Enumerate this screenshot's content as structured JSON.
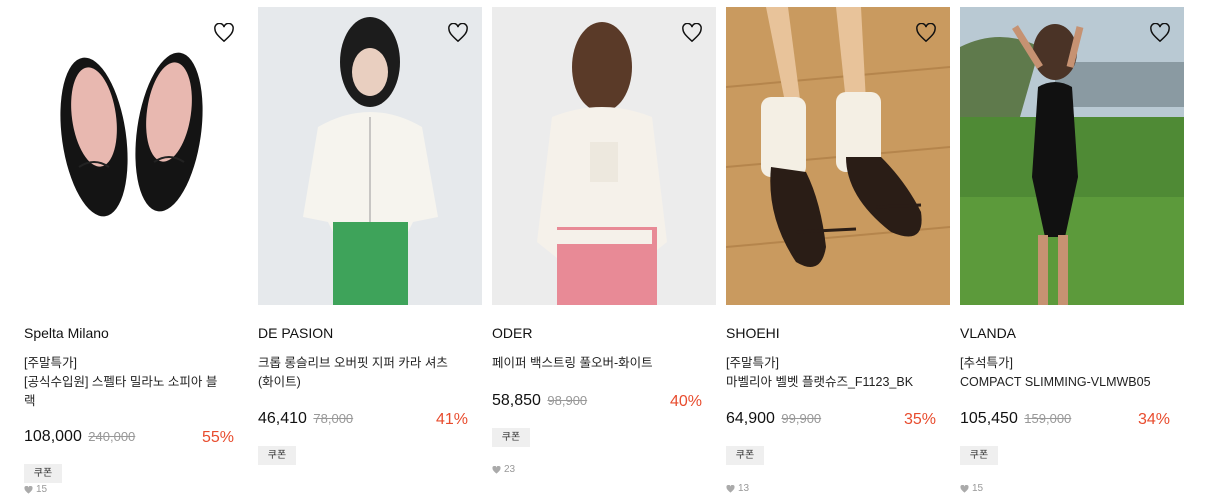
{
  "products": [
    {
      "brand": "Spelta Milano",
      "tag": "[주말특가]",
      "name_line1": "[공식수입원] 스펠타 밀라노 소피아 블",
      "name_line2": "랙",
      "price": "108,000",
      "original_price": "240,000",
      "discount": "55%",
      "coupon": "쿠폰",
      "likes": "15",
      "icon": "heart-outline-icon"
    },
    {
      "brand": "DE PASION",
      "tag": "",
      "name_line1": "크롭 롱슬리브 오버핏 지퍼 카라 셔츠",
      "name_line2": "(화이트)",
      "price": "46,410",
      "original_price": "78,000",
      "discount": "41%",
      "coupon": "쿠폰",
      "likes": "",
      "icon": "heart-outline-icon"
    },
    {
      "brand": "ODER",
      "tag": "",
      "name_line1": "페이퍼 백스트링 풀오버-화이트",
      "name_line2": "",
      "price": "58,850",
      "original_price": "98,900",
      "discount": "40%",
      "coupon": "쿠폰",
      "likes": "23",
      "icon": "heart-outline-icon"
    },
    {
      "brand": "SHOEHI",
      "tag": "[주말특가]",
      "name_line1": "마벨리아 벨벳 플랫슈즈_F1123_BK",
      "name_line2": "",
      "price": "64,900",
      "original_price": "99,900",
      "discount": "35%",
      "coupon": "쿠폰",
      "likes": "13",
      "icon": "heart-outline-icon"
    },
    {
      "brand": "VLANDA",
      "tag": "[추석특가]",
      "name_line1": "COMPACT SLIMMING-VLMWB05",
      "name_line2": "",
      "price": "105,450",
      "original_price": "159,000",
      "discount": "34%",
      "coupon": "쿠폰",
      "likes": "15",
      "icon": "heart-outline-icon"
    }
  ],
  "colors": {
    "discount": "#e84c2e",
    "strike": "#999999",
    "coupon_bg": "#efefef"
  }
}
